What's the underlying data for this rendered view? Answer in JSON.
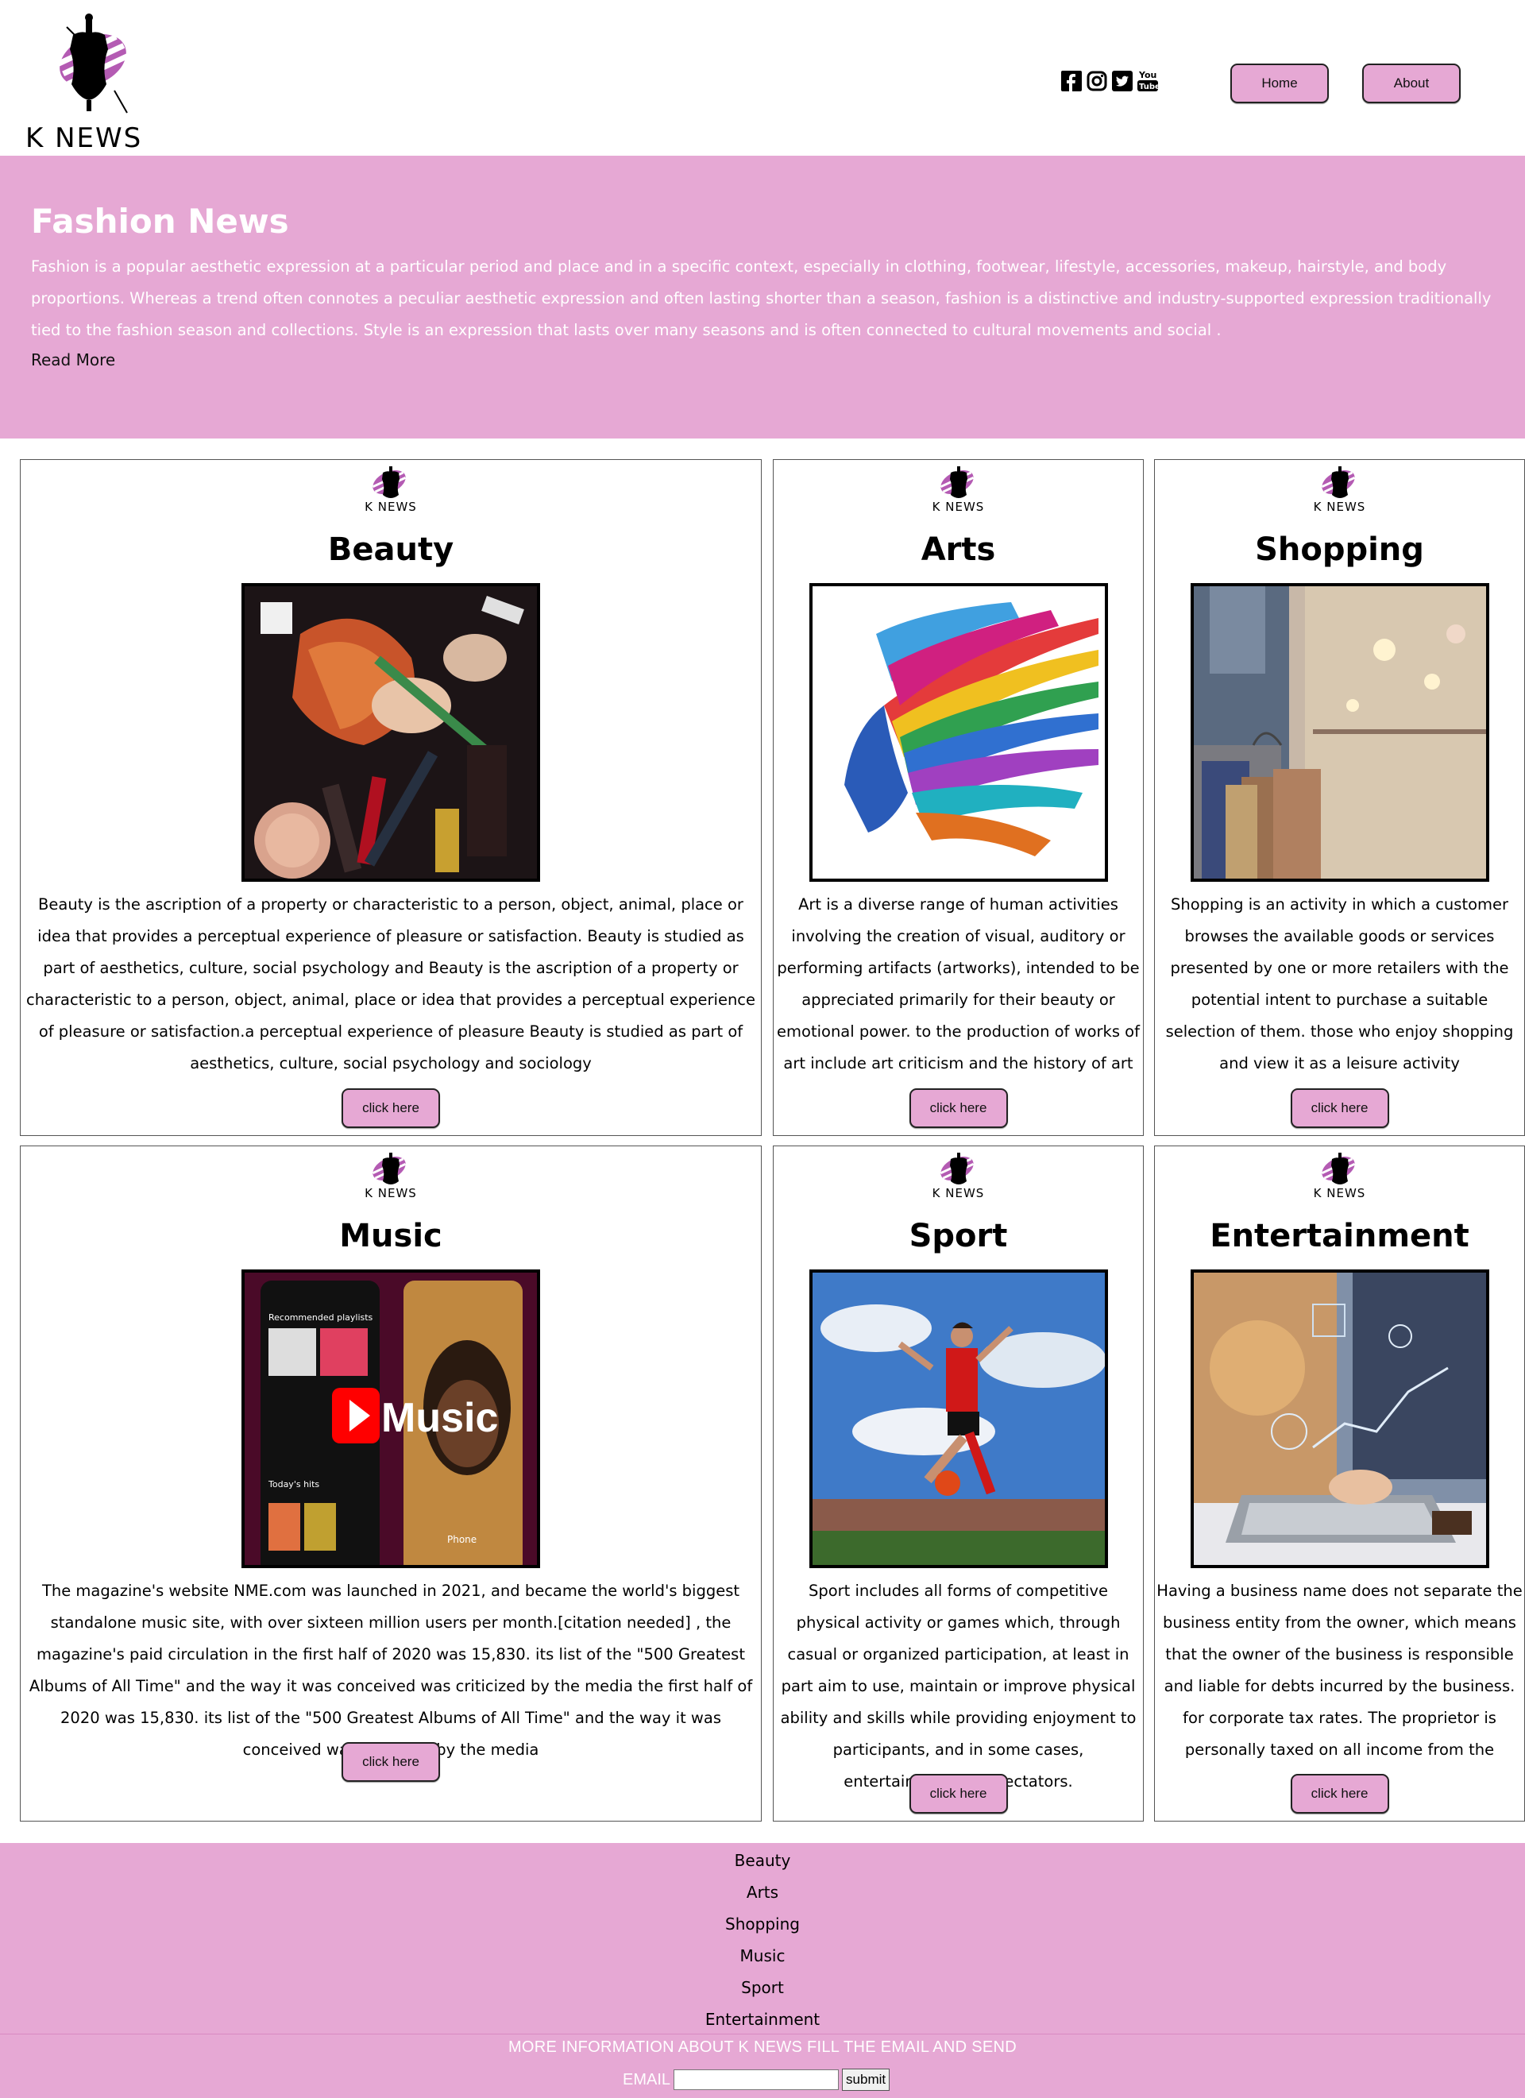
{
  "brand": {
    "name": "K NEWS"
  },
  "header": {
    "socials": [
      "facebook-icon",
      "instagram-icon",
      "twitter-icon",
      "youtube-icon"
    ],
    "nav": {
      "home": "Home",
      "about": "About"
    }
  },
  "hero": {
    "title": "Fashion News",
    "text": "Fashion is a popular aesthetic expression at a particular period and place and in a specific context, especially in clothing, footwear, lifestyle, accessories, makeup, hairstyle, and body proportions. Whereas a trend often connotes a peculiar aesthetic expression and often lasting shorter than a season, fashion is a distinctive and industry-supported expression traditionally tied to the fashion season and collections. Style is an expression that lasts over many seasons and is often connected to cultural movements and social .",
    "read_more": "Read More"
  },
  "cards": [
    {
      "logo": "K NEWS",
      "title": "Beauty",
      "text": "Beauty is the ascription of a property or characteristic to a person, object, animal, place or idea that provides a perceptual experience of pleasure or satisfaction. Beauty is studied as part of aesthetics, culture, social psychology and Beauty is the ascription of a property or characteristic to a person, object, animal, place or idea that provides a perceptual experience of pleasure or satisfaction.a perceptual experience of pleasure Beauty is studied as part of aesthetics, culture, social psychology and sociology",
      "button": "click here"
    },
    {
      "logo": "K NEWS",
      "title": "Arts",
      "text": "Art is a diverse range of human activities involving the creation of visual, auditory or performing artifacts (artworks), intended to be appreciated primarily for their beauty or emotional power. to the production of works of art include art criticism and the history of art",
      "button": "click here"
    },
    {
      "logo": "K NEWS",
      "title": "Shopping",
      "text": "Shopping is an activity in which a customer browses the available goods or services presented by one or more retailers with the potential intent to purchase a suitable selection of them. those who enjoy shopping and view it as a leisure activity",
      "button": "click here"
    },
    {
      "logo": "K NEWS",
      "title": "Music",
      "text": "The magazine's website NME.com was launched in 2021, and became the world's biggest standalone music site, with over sixteen million users per month.[citation needed] , the magazine's paid circulation in the first half of 2020 was 15,830. its list of the \"500 Greatest Albums of All Time\" and the way it was conceived was criticized by the media the first half of 2020 was 15,830. its list of the \"500 Greatest Albums of All Time\" and the way it was conceived was criticized by the media",
      "button": "click here",
      "image_text": {
        "playlists": "Recommended playlists",
        "hits": "Today's hits",
        "brand": "Music",
        "phone": "Phone"
      }
    },
    {
      "logo": "K NEWS",
      "title": "Sport",
      "text": "Sport includes all forms of competitive physical activity or games which, through casual or organized participation, at least in part aim to use, maintain or improve physical ability and skills while providing enjoyment to participants, and in some cases, entertainment for spectators.",
      "button": "click here"
    },
    {
      "logo": "K NEWS",
      "title": "Entertainment",
      "text": "Having a business name does not separate the business entity from the owner, which means that the owner of the business is responsible and liable for debts incurred by the business. for corporate tax rates. The proprietor is personally taxed on all income from the business",
      "button": "click here"
    }
  ],
  "footer": {
    "links": [
      "Beauty",
      "Arts",
      "Shopping",
      "Music",
      "Sport",
      "Entertainment"
    ],
    "info": "MORE INFORMATION ABOUT K NEWS FILL THE EMAIL AND SEND",
    "email_label": "EMAIL",
    "email_value": "",
    "submit": "submit"
  },
  "colors": {
    "accent": "#e6a8d4",
    "button": "#e6a8d4",
    "text_on_accent": "#ffffff"
  }
}
